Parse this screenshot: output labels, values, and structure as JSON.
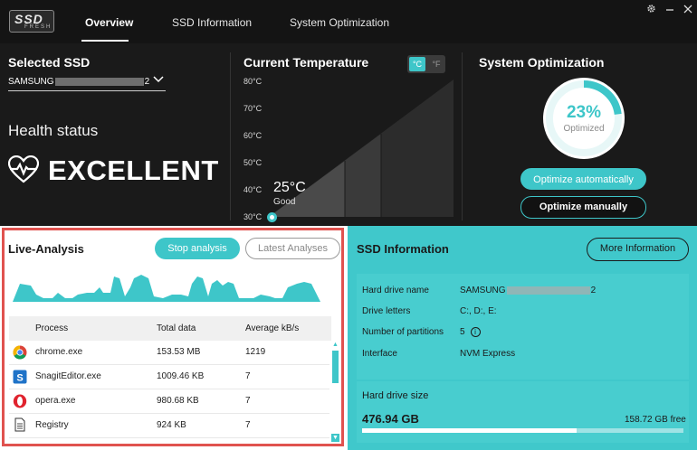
{
  "app": {
    "logo_main": "SSD",
    "logo_sub": "FRESH",
    "tabs": [
      "Overview",
      "SSD Information",
      "System Optimization"
    ],
    "active_tab": "Overview"
  },
  "selected_ssd": {
    "title": "Selected SSD",
    "drive_prefix": "SAMSUNG",
    "drive_suffix": "2"
  },
  "health": {
    "label": "Health status",
    "value": "EXCELLENT"
  },
  "temperature": {
    "title": "Current Temperature",
    "unit_c": "°C",
    "unit_f": "°F",
    "ticks": [
      "80°C",
      "70°C",
      "60°C",
      "50°C",
      "40°C",
      "30°C"
    ],
    "value": "25°C",
    "status": "Good",
    "accent": "#3ec6c9"
  },
  "optimization": {
    "title": "System Optimization",
    "percent": "23%",
    "percent_value": 0.23,
    "label": "Optimized",
    "btn_auto": "Optimize automatically",
    "btn_manual": "Optimize manually"
  },
  "live_analysis": {
    "title": "Live-Analysis",
    "btn_stop": "Stop analysis",
    "btn_latest": "Latest Analyses",
    "columns": [
      "Process",
      "Total data",
      "Average kB/s"
    ],
    "rows": [
      {
        "icon": "chrome-icon",
        "process": "chrome.exe",
        "total": "153.53 MB",
        "avg": "1219"
      },
      {
        "icon": "snagit-icon",
        "process": "SnagitEditor.exe",
        "total": "1009.46 KB",
        "avg": "7"
      },
      {
        "icon": "opera-icon",
        "process": "opera.exe",
        "total": "980.68 KB",
        "avg": "7"
      },
      {
        "icon": "document-icon",
        "process": "Registry",
        "total": "924 KB",
        "avg": "7"
      }
    ]
  },
  "ssd_info": {
    "title": "SSD Information",
    "btn_more": "More Information",
    "rows": [
      {
        "key": "Hard drive name",
        "value_prefix": "SAMSUNG",
        "value_suffix": "2"
      },
      {
        "key": "Drive letters",
        "value": "C:, D:, E:"
      },
      {
        "key": "Number of partitions",
        "value": "5"
      },
      {
        "key": "Interface",
        "value": "NVM Express"
      }
    ],
    "size_label": "Hard drive size",
    "size_value": "476.94 GB",
    "free": "158.72 GB free",
    "used_fraction": 0.667
  }
}
